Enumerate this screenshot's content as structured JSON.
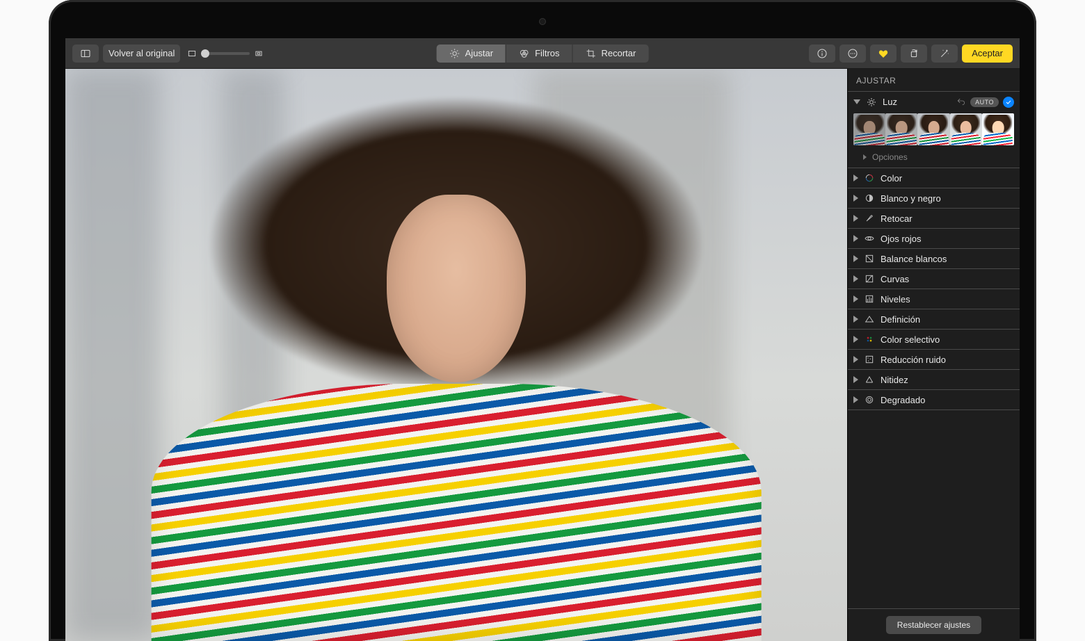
{
  "toolbar": {
    "revert_label": "Volver al original",
    "tabs": {
      "adjust": "Ajustar",
      "filters": "Filtros",
      "crop": "Recortar"
    },
    "accept_label": "Aceptar"
  },
  "sidebar": {
    "header": "AJUSTAR",
    "light": {
      "label": "Luz",
      "auto_badge": "AUTO",
      "options_label": "Opciones",
      "expanded": true
    },
    "items": [
      {
        "id": "color",
        "label": "Color",
        "icon": "color-icon"
      },
      {
        "id": "bw",
        "label": "Blanco y negro",
        "icon": "bw-icon"
      },
      {
        "id": "retouch",
        "label": "Retocar",
        "icon": "retouch-icon"
      },
      {
        "id": "redeye",
        "label": "Ojos rojos",
        "icon": "redeye-icon"
      },
      {
        "id": "whitebalance",
        "label": "Balance blancos",
        "icon": "whitebalance-icon"
      },
      {
        "id": "curves",
        "label": "Curvas",
        "icon": "curves-icon"
      },
      {
        "id": "levels",
        "label": "Niveles",
        "icon": "levels-icon"
      },
      {
        "id": "definition",
        "label": "Definición",
        "icon": "definition-icon"
      },
      {
        "id": "selectivecolor",
        "label": "Color selectivo",
        "icon": "selectivecolor-icon"
      },
      {
        "id": "noisereduction",
        "label": "Reducción ruido",
        "icon": "noisereduction-icon"
      },
      {
        "id": "sharpen",
        "label": "Nitidez",
        "icon": "sharpen-icon"
      },
      {
        "id": "vignette",
        "label": "Degradado",
        "icon": "vignette-icon"
      }
    ],
    "reset_label": "Restablecer ajustes"
  }
}
